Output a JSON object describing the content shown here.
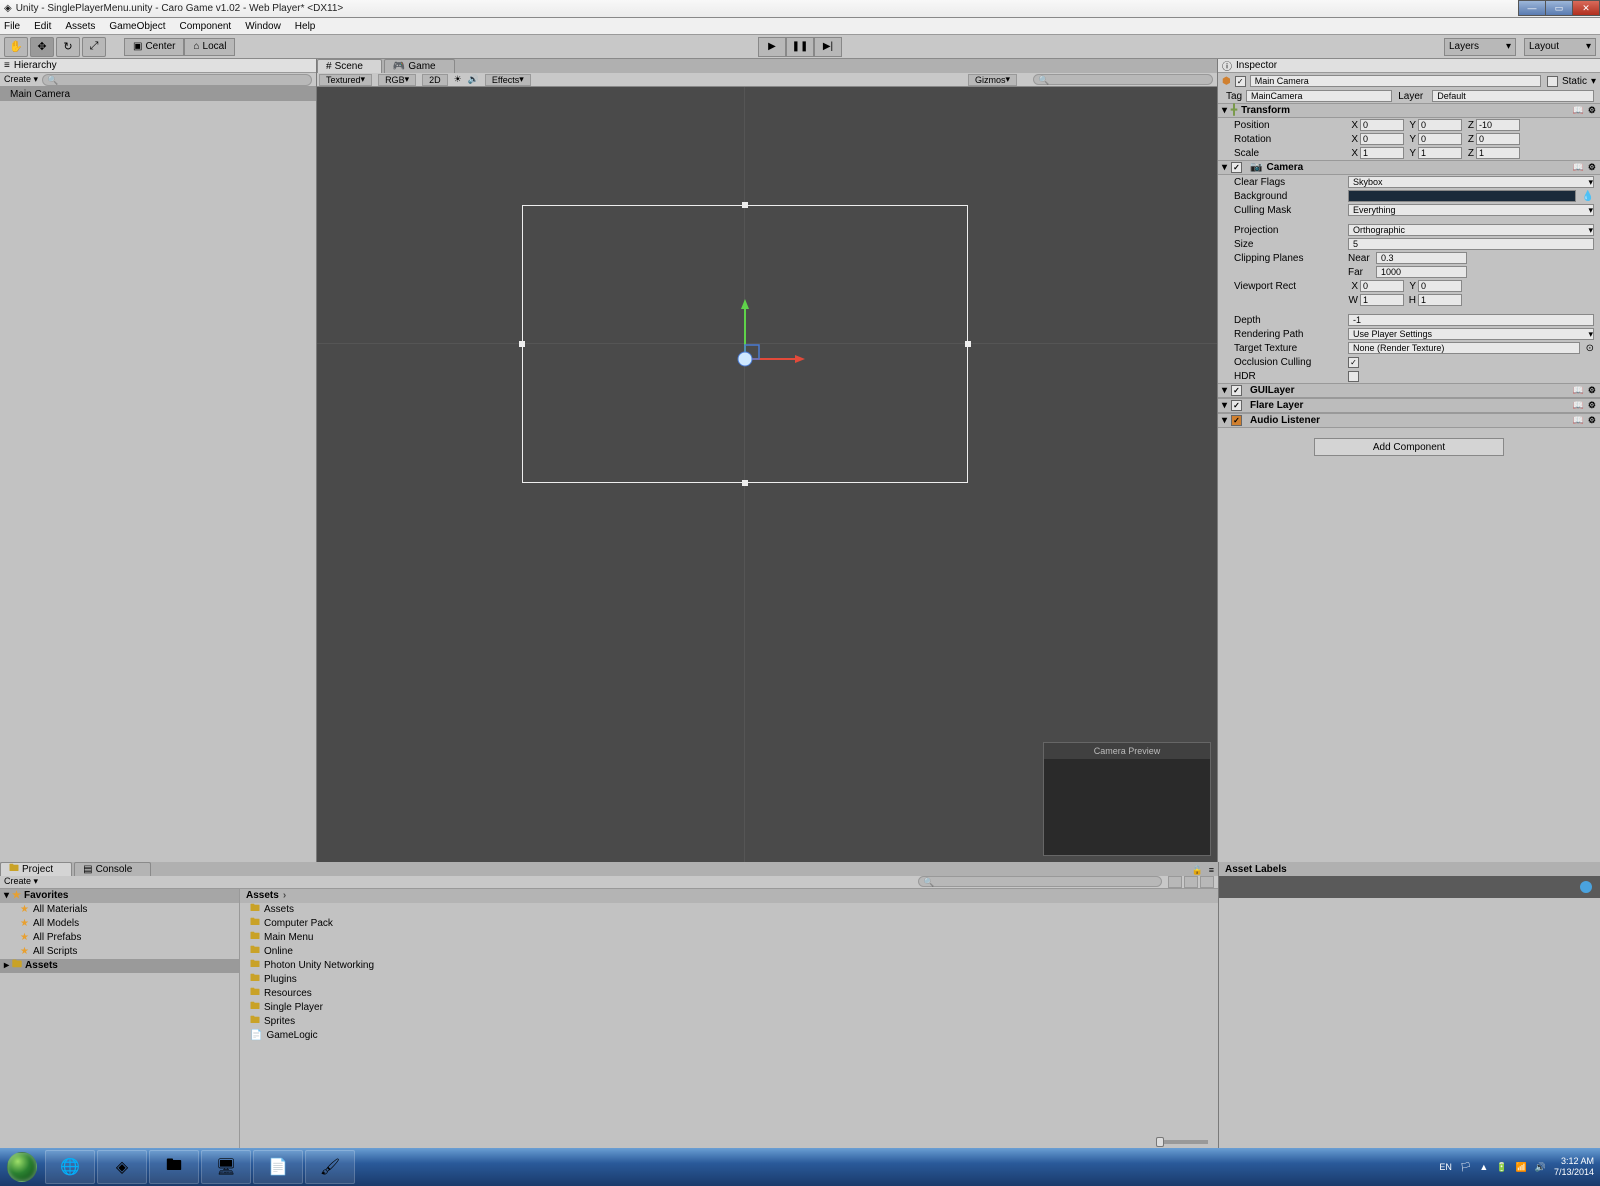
{
  "title": "Unity - SinglePlayerMenu.unity - Caro Game v1.02 - Web Player* <DX11>",
  "menu": [
    "File",
    "Edit",
    "Assets",
    "GameObject",
    "Component",
    "Window",
    "Help"
  ],
  "toolbar": {
    "pivot_center": "Center",
    "pivot_local": "Local",
    "layers": "Layers",
    "layout": "Layout"
  },
  "hierarchy": {
    "tab": "Hierarchy",
    "create": "Create",
    "items": [
      "Main Camera"
    ]
  },
  "scene": {
    "tab_scene": "Scene",
    "tab_game": "Game",
    "shading": "Textured",
    "render": "RGB",
    "mode2d": "2D",
    "effects": "Effects",
    "gizmos": "Gizmos",
    "campreview": "Camera Preview"
  },
  "inspector": {
    "tab": "Inspector",
    "name": "Main Camera",
    "static": "Static",
    "tag_lbl": "Tag",
    "tag": "MainCamera",
    "layer_lbl": "Layer",
    "layer": "Default",
    "transform": {
      "title": "Transform",
      "position": {
        "x": "0",
        "y": "0",
        "z": "-10"
      },
      "rotation": {
        "x": "0",
        "y": "0",
        "z": "0"
      },
      "scale": {
        "x": "1",
        "y": "1",
        "z": "1"
      },
      "pos_lbl": "Position",
      "rot_lbl": "Rotation",
      "scl_lbl": "Scale"
    },
    "camera": {
      "title": "Camera",
      "clear_lbl": "Clear Flags",
      "clear": "Skybox",
      "bg_lbl": "Background",
      "cull_lbl": "Culling Mask",
      "cull": "Everything",
      "proj_lbl": "Projection",
      "proj": "Orthographic",
      "size_lbl": "Size",
      "size": "5",
      "clip_lbl": "Clipping Planes",
      "near_lbl": "Near",
      "near": "0.3",
      "far_lbl": "Far",
      "far": "1000",
      "vp_lbl": "Viewport Rect",
      "vp": {
        "x": "0",
        "y": "0",
        "w": "1",
        "h": "1"
      },
      "depth_lbl": "Depth",
      "depth": "-1",
      "rp_lbl": "Rendering Path",
      "rp": "Use Player Settings",
      "tt_lbl": "Target Texture",
      "tt": "None (Render Texture)",
      "occ_lbl": "Occlusion Culling",
      "hdr_lbl": "HDR"
    },
    "guilayer": "GUILayer",
    "flarelayer": "Flare Layer",
    "audiolistener": "Audio Listener",
    "addcomp": "Add Component"
  },
  "project": {
    "tab_project": "Project",
    "tab_console": "Console",
    "create": "Create",
    "favorites": "Favorites",
    "fav_items": [
      "All Materials",
      "All Models",
      "All Prefabs",
      "All Scripts"
    ],
    "assets_root": "Assets",
    "breadcrumb": "Assets",
    "items": [
      {
        "name": "Assets",
        "t": "folder"
      },
      {
        "name": "Computer Pack",
        "t": "folder"
      },
      {
        "name": "Main Menu",
        "t": "folder"
      },
      {
        "name": "Online",
        "t": "folder"
      },
      {
        "name": "Photon Unity Networking",
        "t": "folder"
      },
      {
        "name": "Plugins",
        "t": "folder"
      },
      {
        "name": "Resources",
        "t": "folder"
      },
      {
        "name": "Single Player",
        "t": "folder"
      },
      {
        "name": "Sprites",
        "t": "folder"
      },
      {
        "name": "GameLogic",
        "t": "script"
      }
    ]
  },
  "assetlabels": "Asset Labels",
  "tray": {
    "lang": "EN",
    "time": "3:12 AM",
    "date": "7/13/2014"
  }
}
